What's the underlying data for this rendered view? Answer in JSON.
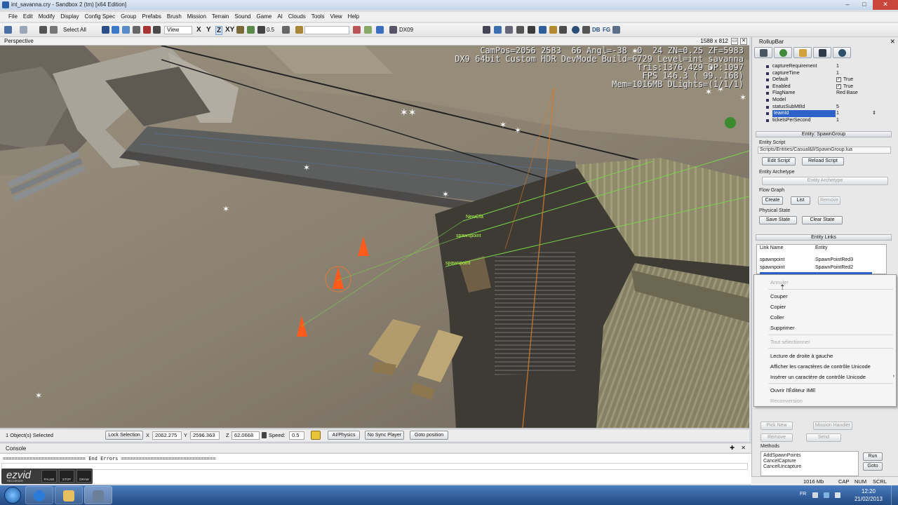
{
  "window": {
    "title": "int_savanna.cry - Sandbox 2 (tm) [x64 Edition]",
    "min": "–",
    "max": "□",
    "close": "✕"
  },
  "menu": [
    "File",
    "Edit",
    "Modify",
    "Display",
    "Config Spec",
    "Group",
    "Prefabs",
    "Brush",
    "Mission",
    "Terrain",
    "Sound",
    "Game",
    "AI",
    "Clouds",
    "Tools",
    "View",
    "Help"
  ],
  "toolbar": {
    "select_all": "Select All",
    "view": "View",
    "axis_x": "X",
    "axis_y": "Y",
    "axis_z": "Z",
    "axis_xy": "XY",
    "grid_value": "0.5",
    "render_mode": "DX09",
    "db": "DB",
    "fg": "FG"
  },
  "viewport": {
    "label": "Perspective",
    "resolution": "1588 x 812",
    "hud_lines": [
      "CamPos=2056 2583  66 Angl=-38  0  24 ZN=0.25 ZF=5983",
      "DX9 64bit Custom HDR DevMode Build=6729 Level=int_savanna",
      "Tris:1376,429 DP:1097",
      "FPS 146.3 ( 99..168)",
      "Mem=1016MB DLights=(1/1/1)"
    ],
    "spawn_labels": [
      "NewCfa",
      "spawnpoint",
      "spawnpoint"
    ]
  },
  "rollup": {
    "title": "RollupBar",
    "close": "✕",
    "properties": [
      {
        "name": "captureRequirement",
        "value": "1"
      },
      {
        "name": "captureTime",
        "value": "1"
      },
      {
        "name": "Default",
        "value": "True",
        "checkbox": true
      },
      {
        "name": "Enabled",
        "value": "True",
        "checkbox": true
      },
      {
        "name": "FlagName",
        "value": "Red Base"
      },
      {
        "name": "Model",
        "value": ""
      },
      {
        "name": "statusSubMtlId",
        "value": "5"
      },
      {
        "name": "teamId",
        "value": "1",
        "selected": true
      },
      {
        "name": "ticketsPerSecond",
        "value": "1"
      }
    ],
    "entity_section": "Entity: SpawnGroup",
    "entity_script_label": "Entity Script",
    "entity_script_path": "Scripts/Entities/Casual&ll/SpawnGroup.lua",
    "edit_script": "Edit Script",
    "reload_script": "Reload Script",
    "entity_archetype_label": "Entity Archetype",
    "entity_archetype_btn": "Entity Archetype",
    "flow_graph_label": "Flow Graph",
    "create": "Create",
    "list": "List",
    "remove": "Remove",
    "physical_state_label": "Physical State",
    "save_state": "Save State",
    "clear_state": "Clear State",
    "entity_links_section": "Entity Links",
    "links_headers": [
      "Link Name",
      "Entity"
    ],
    "links": [
      {
        "name": "spawnpoint",
        "entity": "SpawnPointRed3"
      },
      {
        "name": "spawnpoint",
        "entity": "SpawnPointRed2"
      }
    ],
    "pick_new": "Pick New",
    "mission_handler": "Mission Handler",
    "remove_link": "Remove",
    "send": "Send",
    "methods_label": "Methods",
    "methods": [
      "AddSpawnPoints",
      "CancelCapture",
      "CancelUncapture"
    ],
    "run": "Run",
    "goto": "Goto"
  },
  "context_menu": [
    {
      "label": "Annuler",
      "disabled": true
    },
    {
      "label": "Couper",
      "disabled": false
    },
    {
      "label": "Copier",
      "disabled": false
    },
    {
      "label": "Coller",
      "disabled": false
    },
    {
      "label": "Supprimer",
      "disabled": false
    },
    {
      "label": "Tout sélectionner",
      "disabled": true
    },
    {
      "label": "Lecture de droite à gauche",
      "disabled": false
    },
    {
      "label": "Afficher les caractères de contrôle Unicode",
      "disabled": false
    },
    {
      "label": "Insérer un caractère de contrôle Unicode",
      "disabled": false
    },
    {
      "label": "Ouvrir l'Éditeur IME",
      "disabled": false
    },
    {
      "label": "Reconversion",
      "disabled": true
    }
  ],
  "status": {
    "selected": "1 Object(s) Selected",
    "lock_selection": "Lock Selection",
    "x_label": "X",
    "x": "2062.275",
    "y_label": "Y",
    "y": "2596.363",
    "z_label": "Z",
    "z": "62.0668",
    "speed_label": "Speed:",
    "speed": "0.5",
    "ai_physics": "AI/Physics",
    "no_sync_player": "No Sync Player",
    "goto_position": "Goto position"
  },
  "console": {
    "label": "Console",
    "line": "============================ End Errors ================================"
  },
  "ezvid": {
    "logo": "ezvid",
    "sub": "RECORDER",
    "pause": "PAUSE",
    "stop": "STOP",
    "draw": "DRAW"
  },
  "memory": {
    "mem": "1016 Mb",
    "cap": "CAP",
    "num": "NUM",
    "scrl": "SCRL"
  },
  "taskbar": {
    "lang": "FR",
    "time": "12:20",
    "date": "21/02/2013"
  }
}
